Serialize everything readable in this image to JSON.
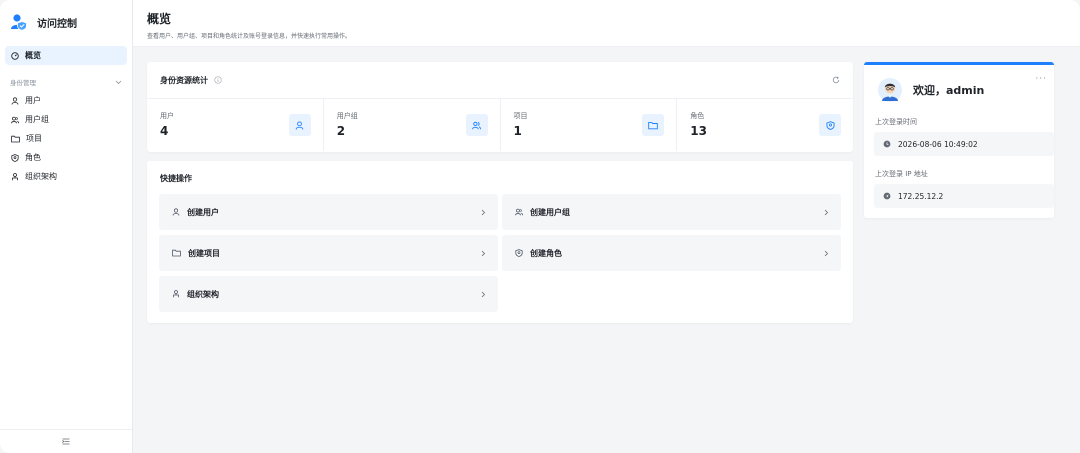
{
  "sidebar": {
    "brand_title": "访问控制",
    "overview_label": "概览",
    "group_label": "身份管理",
    "items": [
      {
        "label": "用户",
        "icon": "user-icon"
      },
      {
        "label": "用户组",
        "icon": "users-icon"
      },
      {
        "label": "项目",
        "icon": "folder-icon"
      },
      {
        "label": "角色",
        "icon": "shield-icon"
      },
      {
        "label": "组织架构",
        "icon": "org-icon"
      }
    ]
  },
  "header": {
    "title": "概览",
    "subtitle": "查看用户、用户组、项目和角色统计及账号登录信息，并快速执行常用操作。"
  },
  "stats": {
    "title": "身份资源统计",
    "items": [
      {
        "label": "用户",
        "value": "4"
      },
      {
        "label": "用户组",
        "value": "2"
      },
      {
        "label": "项目",
        "value": "1"
      },
      {
        "label": "角色",
        "value": "13"
      }
    ]
  },
  "quick": {
    "title": "快捷操作",
    "buttons": [
      {
        "label": "创建用户"
      },
      {
        "label": "创建用户组"
      },
      {
        "label": "创建项目"
      },
      {
        "label": "创建角色"
      },
      {
        "label": "组织架构"
      }
    ]
  },
  "welcome": {
    "greeting": "欢迎，admin",
    "last_login_time_label": "上次登录时间",
    "last_login_time": "2026-08-06 10:49:02",
    "last_login_ip_label": "上次登录 IP 地址",
    "last_login_ip": "172.25.12.2"
  },
  "colors": {
    "accent": "#1e80ff",
    "accent_bg": "#e8f3ff"
  }
}
